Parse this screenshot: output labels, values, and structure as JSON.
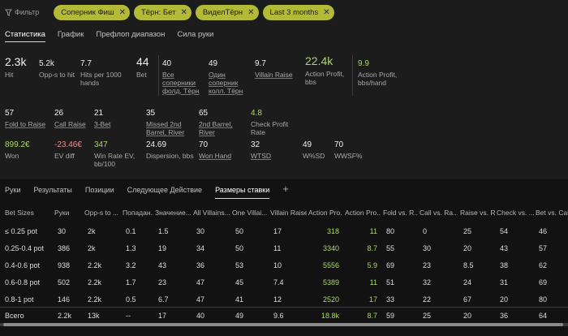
{
  "filter": {
    "label": "Фильтр"
  },
  "chips": [
    "Соперник Фиш",
    "Тёрн: Бет",
    "ВиделТёрн",
    "Last 3 months"
  ],
  "tabs1": [
    "Статистика",
    "График",
    "Префлоп диапазон",
    "Сила руки"
  ],
  "stats": {
    "hit": {
      "v": "2.3k",
      "l": "Hit"
    },
    "opps_to_hit": {
      "v": "5.2k",
      "l": "Opp-s to hit"
    },
    "hits_per_1000": {
      "v": "7.7",
      "l": "Hits per 1000 hands"
    },
    "bet": {
      "v": "44",
      "l": "Bet"
    },
    "all_opp_fold": {
      "v": "40",
      "l": "Все соперники фолд. Тёрн"
    },
    "one_opp_call": {
      "v": "49",
      "l": "Один соперник колл. Тёрн"
    },
    "villain_raise": {
      "v": "9.7",
      "l": "Villain Raise"
    },
    "action_profit": {
      "v": "22.4k",
      "l": "Action Profit, bbs"
    },
    "action_profit_hand": {
      "v": "9.9",
      "l": "Action Profit, bbs/hand"
    },
    "fold_to_raise": {
      "v": "57",
      "l": "Fold to Raise"
    },
    "call_raise": {
      "v": "26",
      "l": "Call Raise"
    },
    "three_bet": {
      "v": "21",
      "l": "3-Bet"
    },
    "missed_2nd_barrel": {
      "v": "35",
      "l": "Missed 2nd Barrel, River"
    },
    "second_barrel": {
      "v": "65",
      "l": "2nd Barrel, River"
    },
    "check_profit": {
      "v": "4.8",
      "l": "Check Profit Rate"
    },
    "won": {
      "v": "899.2€",
      "l": "Won"
    },
    "ev_diff": {
      "v": "-23.46€",
      "l": "EV diff"
    },
    "win_rate_ev": {
      "v": "347",
      "l": "Win Rate EV, bb/100"
    },
    "dispersion": {
      "v": "24.69",
      "l": "Dispersion, bbs"
    },
    "won_hand": {
      "v": "70",
      "l": "Won Hand"
    },
    "wtsd": {
      "v": "32",
      "l": "WTSD"
    },
    "wsd": {
      "v": "49",
      "l": "W%SD"
    },
    "wwsf": {
      "v": "70",
      "l": "WWSF%"
    }
  },
  "tabs2": [
    "Руки",
    "Результаты",
    "Позиции",
    "Следующее Действие",
    "Размеры ставки",
    "+"
  ],
  "table": {
    "headers": [
      "Bet Sizes",
      "Руки",
      "Opp-s to ...",
      "Попадан...",
      "Значение...",
      "All Villains...",
      "One Villai...",
      "Villain Raise",
      "Action Pro...",
      "Action Pro...",
      "Fold vs. R...",
      "Call vs. Ra...",
      "Raise vs. R...",
      "Check vs. ...",
      "Bet vs. Call"
    ],
    "rows": [
      [
        "≤ 0.25 pot",
        "30",
        "2k",
        "0.1",
        "1.5",
        "30",
        "50",
        "17",
        "318",
        "11",
        "80",
        "0",
        "25",
        "54",
        "46"
      ],
      [
        "0.25-0.4 pot",
        "386",
        "2k",
        "1.3",
        "19",
        "34",
        "50",
        "11",
        "3340",
        "8.7",
        "55",
        "30",
        "20",
        "43",
        "57"
      ],
      [
        "0.4-0.6 pot",
        "938",
        "2.2k",
        "3.2",
        "43",
        "36",
        "53",
        "10",
        "5556",
        "5.9",
        "69",
        "23",
        "8.5",
        "38",
        "62"
      ],
      [
        "0.6-0.8 pot",
        "502",
        "2.2k",
        "1.7",
        "23",
        "47",
        "45",
        "7.4",
        "5389",
        "11",
        "51",
        "32",
        "24",
        "31",
        "69"
      ],
      [
        "0.8-1 pot",
        "146",
        "2.2k",
        "0.5",
        "6.7",
        "47",
        "41",
        "12",
        "2520",
        "17",
        "33",
        "22",
        "67",
        "20",
        "80"
      ]
    ],
    "total": [
      "Всего",
      "2.2k",
      "13k",
      "--",
      "17",
      "40",
      "49",
      "9.6",
      "18.8k",
      "8.7",
      "59",
      "25",
      "20",
      "36",
      "64"
    ]
  },
  "colors": {
    "accent": "#b3ba38",
    "positive": "#a8d96a",
    "negative": "#e98e8e"
  }
}
